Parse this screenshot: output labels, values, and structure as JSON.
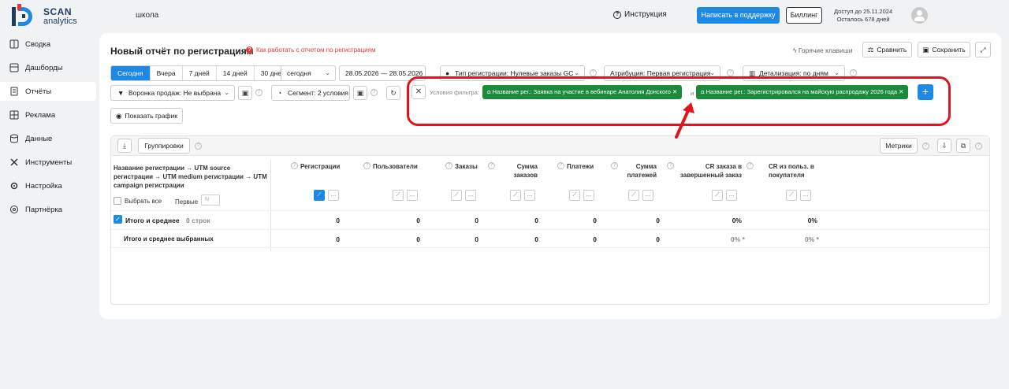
{
  "brand": {
    "line1": "SCAN",
    "line2": "analytics"
  },
  "header": {
    "project": "школа",
    "instruction": "Инструкция",
    "support": "Написать в поддержку",
    "billing": "Биллинг",
    "access_until": "Доступ до 25.11.2024",
    "days_left": "Осталось 678 дней"
  },
  "sidebar": {
    "items": [
      {
        "label": "Сводка",
        "icon": "summary-icon"
      },
      {
        "label": "Дашборды",
        "icon": "dashboard-icon"
      },
      {
        "label": "Отчёты",
        "icon": "reports-icon",
        "active": true
      },
      {
        "label": "Реклама",
        "icon": "ads-icon"
      },
      {
        "label": "Данные",
        "icon": "database-icon"
      },
      {
        "label": "Инструменты",
        "icon": "tools-icon"
      },
      {
        "label": "Настройка",
        "icon": "settings-icon"
      },
      {
        "label": "Партнёрка",
        "icon": "partners-icon"
      }
    ]
  },
  "report": {
    "title": "Новый отчёт по регистрациям",
    "help_link": "Как работать с отчетом по регистрациям",
    "hotkeys": "Горячие клавиши",
    "compare": "Сравнить",
    "save": "Сохранить"
  },
  "periods": [
    "Сегодня",
    "Вчера",
    "7 дней",
    "14 дней",
    "30 дней"
  ],
  "period_select": "сегодня",
  "date_from": "28.05.2026",
  "date_sep": "—",
  "date_to": "28.05.2026",
  "reg_type": "Тип регистрации: Нулевые заказы GC",
  "attribution": "Атрибуция: Первая регистрация",
  "detail": "Детализация:  по дням",
  "funnel": "Воронка продаж: Не выбрана",
  "segment": "Сегмент: 2 условия",
  "filter": {
    "label": "Условия фильтра:",
    "and": "и",
    "chip1": "Название рег.: Заявка на участие в вебинаре Анатолия Донского",
    "chip2": "Название рег.: Зарегистрировался на майскую распродажу 2026 года"
  },
  "show_chart": "Показать график",
  "table": {
    "grouping": "Группировки",
    "metrics": "Метрики",
    "first_col": "Название регистрации → UTM source регистрации → UTM medium регистрации → UTM campaign регистрации",
    "select_all": "Выбрать все",
    "first_label": "Первые",
    "first_placeholder": "N",
    "columns": [
      "Регистрации",
      "Пользователи",
      "Заказы",
      "Сумма заказов",
      "Платежи",
      "Сумма платежей",
      "CR заказа в завершенный заказ",
      "CR из польз. в покупателя"
    ],
    "total_label": "Итого и среднее",
    "total_rows": "0 строк",
    "total_values": [
      "0",
      "0",
      "0",
      "0",
      "0",
      "0",
      "0%",
      "0%"
    ],
    "selected_label": "Итого и среднее выбранных",
    "selected_values": [
      "0",
      "0",
      "0",
      "0",
      "0",
      "0",
      "0% *",
      "0% *"
    ]
  }
}
